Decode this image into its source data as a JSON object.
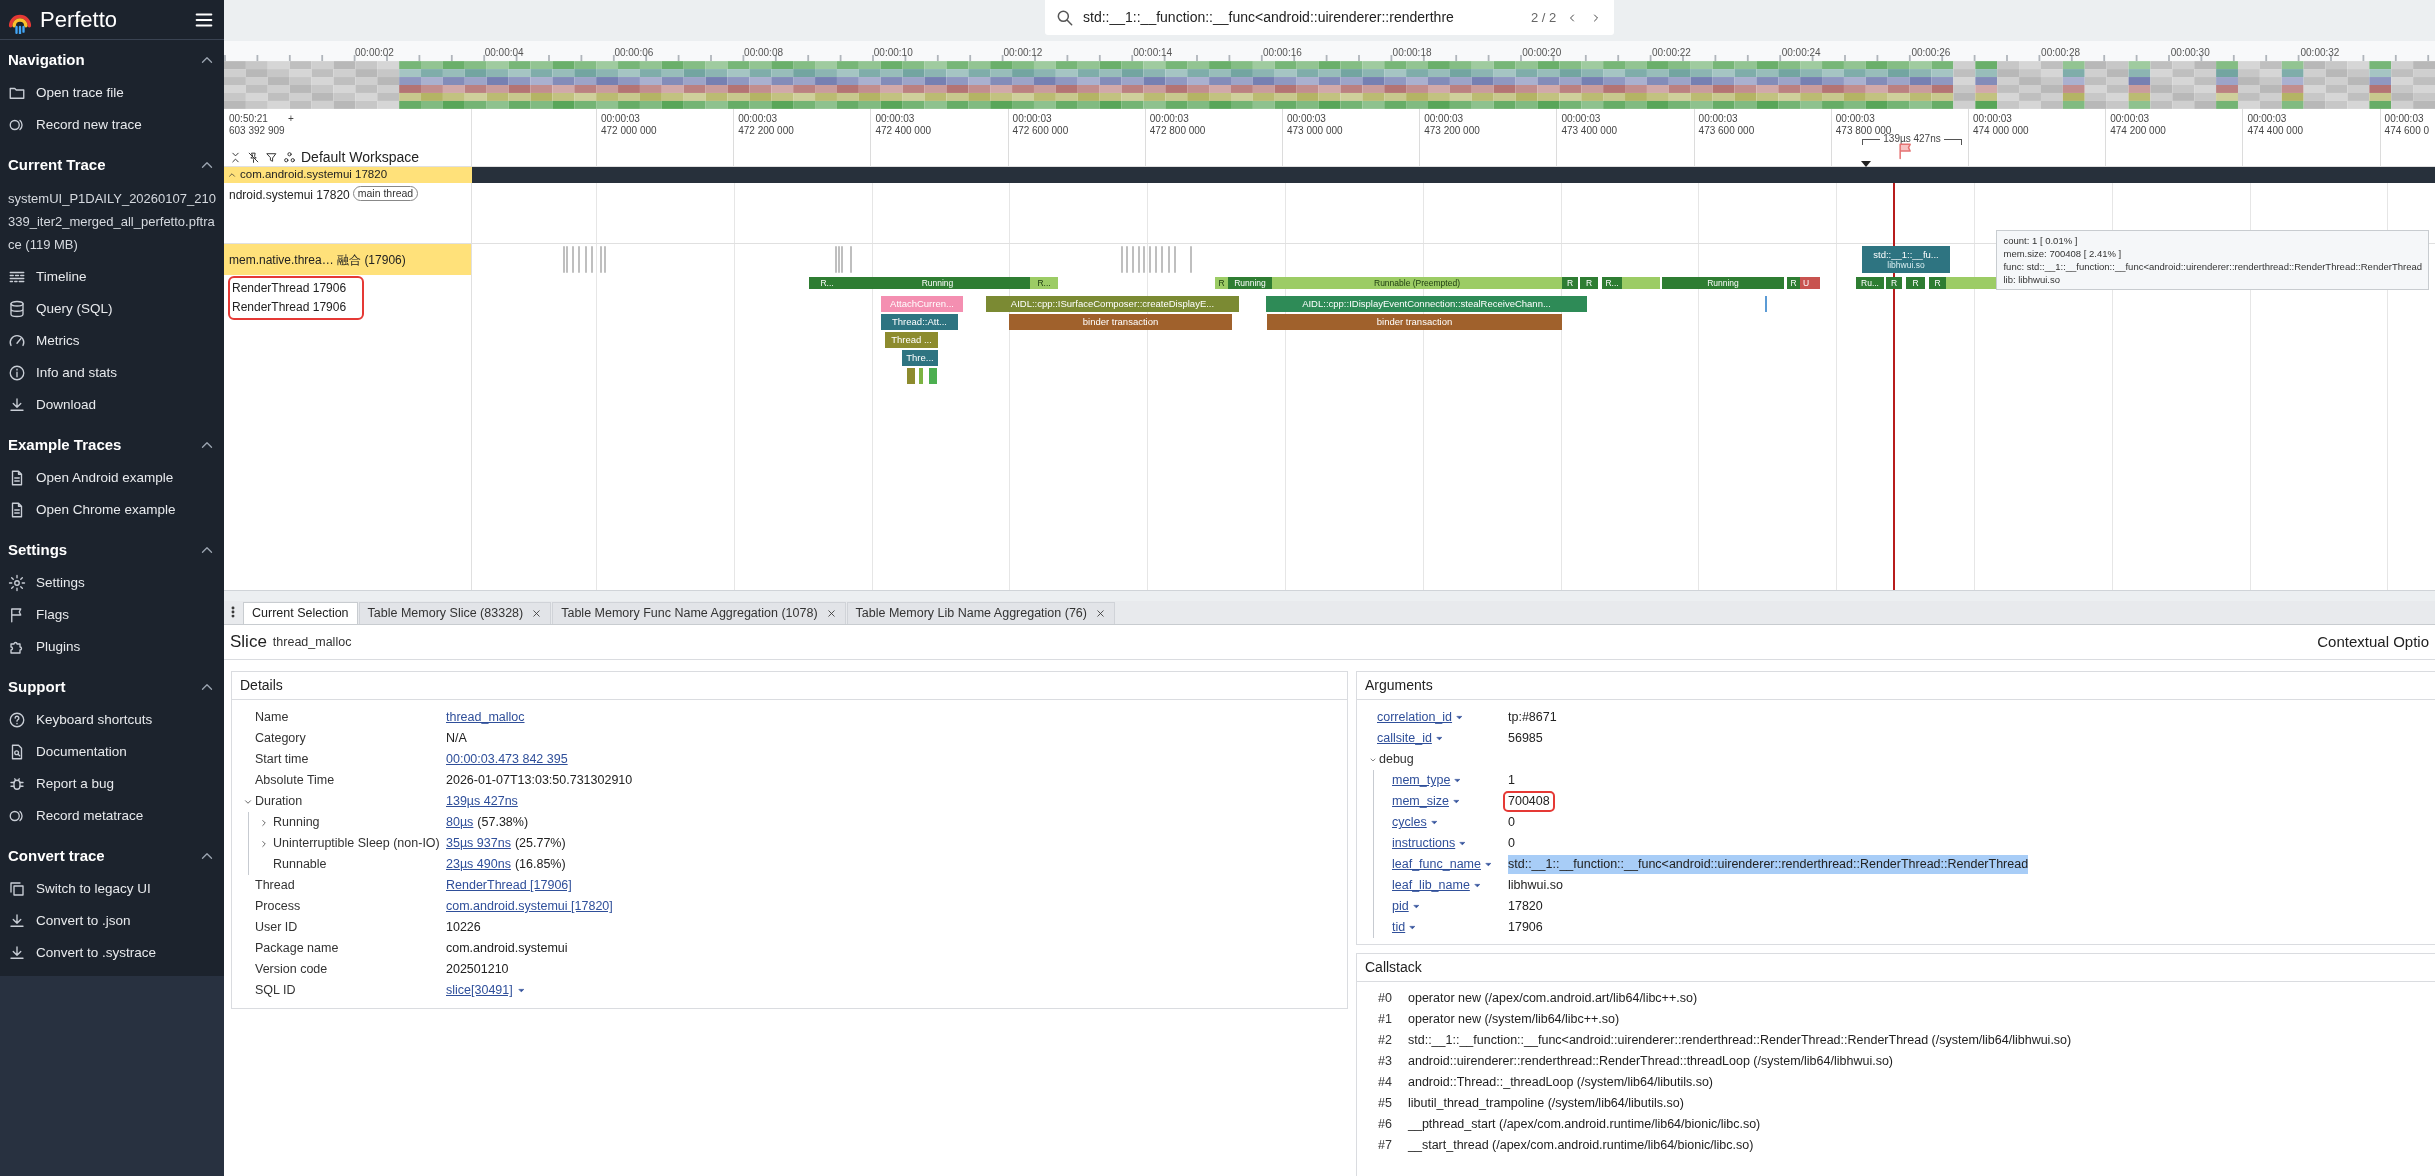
{
  "sidebar": {
    "title": "Perfetto",
    "sections": [
      {
        "title": "Navigation",
        "expanded": true,
        "items": [
          "Open trace file",
          "Record new trace"
        ]
      },
      {
        "title": "Current Trace",
        "expanded": true,
        "trace_file": "systemUI_P1DAILY_20260107_210339_iter2_merged_all_perfetto.pftrace (119 MB)",
        "items": [
          "Timeline",
          "Query (SQL)",
          "Metrics",
          "Info and stats",
          "Download"
        ]
      },
      {
        "title": "Example Traces",
        "expanded": true,
        "items": [
          "Open Android example",
          "Open Chrome example"
        ]
      },
      {
        "title": "Settings",
        "expanded": true,
        "items": [
          "Settings",
          "Flags",
          "Plugins"
        ]
      },
      {
        "title": "Support",
        "expanded": true,
        "items": [
          "Keyboard shortcuts",
          "Documentation",
          "Report a bug",
          "Record metatrace"
        ]
      },
      {
        "title": "Convert trace",
        "expanded": true,
        "items": [
          "Switch to legacy UI",
          "Convert to .json",
          "Convert to .systrace"
        ]
      }
    ]
  },
  "search": {
    "value": "std::__1::__function::__func<android::uirenderer::renderthre",
    "match_count": "2 / 2"
  },
  "overview": {
    "tick_labels": [
      "00:00:02",
      "00:00:04",
      "00:00:06",
      "00:00:08",
      "00:00:10",
      "00:00:12",
      "00:00:14",
      "00:00:16",
      "00:00:18",
      "00:00:20",
      "00:00:22",
      "00:00:24",
      "00:00:26",
      "00:00:28",
      "00:00:30",
      "00:00:32"
    ]
  },
  "timeline": {
    "origin_time": "00:50:21",
    "origin_plus": "+",
    "origin_ns": "603 392 909",
    "workspace": "Default Workspace",
    "measurement": "139µs 427ns",
    "ticks": [
      {
        "time": "00:00:03",
        "ns": "472 000 000"
      },
      {
        "time": "00:00:03",
        "ns": "472 200 000"
      },
      {
        "time": "00:00:03",
        "ns": "472 400 000"
      },
      {
        "time": "00:00:03",
        "ns": "472 600 000"
      },
      {
        "time": "00:00:03",
        "ns": "472 800 000"
      },
      {
        "time": "00:00:03",
        "ns": "473 000 000"
      },
      {
        "time": "00:00:03",
        "ns": "473 200 000"
      },
      {
        "time": "00:00:03",
        "ns": "473 400 000"
      },
      {
        "time": "00:00:03",
        "ns": "473 600 000"
      },
      {
        "time": "00:00:03",
        "ns": "473 800 000"
      },
      {
        "time": "00:00:03",
        "ns": "474 000 000"
      },
      {
        "time": "00:00:03",
        "ns": "474 200 000"
      },
      {
        "time": "00:00:03",
        "ns": "474 400 000"
      },
      {
        "time": "00:00:03",
        "ns": "474 600 0"
      }
    ]
  },
  "tracks": {
    "group": {
      "title": "com.android.systemui 17820",
      "expanded": true
    },
    "main_thread": {
      "label": "ndroid.systemui 17820",
      "chip": "main thread"
    },
    "mem_track": {
      "label": "mem.native.threa… 融合 (17906)",
      "slice": {
        "title": "std::__1::__fu...",
        "subtitle": "libhwui.so"
      }
    },
    "tooltip": [
      "count: 1 [ 0.01% ]",
      "mem.size: 700408 [ 2.41% ]",
      "func: std::__1::__function::__func<android::uirenderer::renderthread::RenderThread::RenderThread",
      "lib: libhwui.so"
    ],
    "render_threads": {
      "highlighted": true,
      "labels": [
        "RenderThread 17906",
        "RenderThread 17906"
      ]
    },
    "thread_states": [
      {
        "kind": "running",
        "label": "R..."
      },
      {
        "kind": "running",
        "label": "Running"
      },
      {
        "kind": "runnable",
        "label": "R..."
      },
      {
        "kind": "runnable",
        "label": "R"
      },
      {
        "kind": "running",
        "label": "Running"
      },
      {
        "kind": "runnable",
        "label": "Runnable (Preempted)"
      },
      {
        "kind": "running",
        "label": "R"
      },
      {
        "kind": "running",
        "label": "R"
      },
      {
        "kind": "running",
        "label": "R..."
      },
      {
        "kind": "runnable"
      },
      {
        "kind": "running",
        "label": "Running"
      },
      {
        "kind": "running",
        "label": "R"
      },
      {
        "kind": "uninterruptible",
        "label": "U"
      },
      {
        "kind": "uninterruptible"
      },
      {
        "kind": "running",
        "label": "Ru..."
      },
      {
        "kind": "running",
        "label": "R"
      },
      {
        "kind": "running",
        "label": "R"
      },
      {
        "kind": "running",
        "label": "R"
      },
      {
        "kind": "runnable"
      }
    ],
    "slices": [
      {
        "label": "AttachCurren...",
        "color": "#f48fb1"
      },
      {
        "label": "Thread::Att...",
        "color": "#2e7481"
      },
      {
        "label": "Thread ...",
        "color": "#8d8b2e"
      },
      {
        "label": "Thre...",
        "color": "#2e7481"
      },
      {
        "color": "#8d8b2e"
      },
      {
        "color": "#7cb342"
      },
      {
        "color": "#4caf50"
      },
      {
        "label": "AIDL::cpp::ISurfaceComposer::createDisplayE...",
        "color": "#7b8a33"
      },
      {
        "label": "binder transaction",
        "color": "#a0612c"
      },
      {
        "label": "AIDL::cpp::IDisplayEventConnection::stealReceiveChann...",
        "color": "#2e8b57"
      },
      {
        "label": "binder transaction",
        "color": "#a0612c"
      },
      {
        "color": "#5b9bd5"
      }
    ]
  },
  "tabs": [
    {
      "label": "Current Selection",
      "selected": true,
      "closable": false
    },
    {
      "label": "Table Memory Slice (83328)",
      "selected": false,
      "closable": true
    },
    {
      "label": "Table Memory Func Name Aggregation (1078)",
      "selected": false,
      "closable": true
    },
    {
      "label": "Table Memory Lib Name Aggregation (76)",
      "selected": false,
      "closable": true
    }
  ],
  "selection": {
    "kind_label": "Slice",
    "name": "thread_malloc",
    "contextual": "Contextual Optio"
  },
  "details": {
    "title": "Details",
    "rows": [
      {
        "label": "Name",
        "value": "thread_malloc",
        "link": true
      },
      {
        "label": "Category",
        "value": "N/A",
        "link": false
      },
      {
        "label": "Start time",
        "value": "00:00:03.473 842 395",
        "link": true
      },
      {
        "label": "Absolute Time",
        "value": "2026-01-07T13:03:50.731302910",
        "link": false
      },
      {
        "label": "Duration",
        "value": "139µs 427ns",
        "link": true,
        "expanded": true,
        "children": [
          {
            "label": "Running",
            "value": "80µs",
            "suffix": "(57.38%)",
            "link": true,
            "expanded": false
          },
          {
            "label": "Uninterruptible Sleep (non-IO)",
            "value": "35µs 937ns",
            "suffix": "(25.77%)",
            "link": true,
            "expanded": false
          },
          {
            "label": "Runnable",
            "value": "23µs 490ns",
            "suffix": "(16.85%)",
            "link": true
          }
        ]
      },
      {
        "label": "Thread",
        "value": "RenderThread [17906]",
        "link": true
      },
      {
        "label": "Process",
        "value": "com.android.systemui [17820]",
        "link": true
      },
      {
        "label": "User ID",
        "value": "10226",
        "link": false
      },
      {
        "label": "Package name",
        "value": "com.android.systemui",
        "link": false
      },
      {
        "label": "Version code",
        "value": "202501210",
        "link": false
      },
      {
        "label": "SQL ID",
        "value": "slice[30491]",
        "link": true,
        "menu": true
      }
    ]
  },
  "arguments": {
    "title": "Arguments",
    "rows": [
      {
        "key": "correlation_id",
        "value": "tp:#8671",
        "highlighted": false,
        "text_selected": false
      },
      {
        "key": "callsite_id",
        "value": "56985",
        "highlighted": false,
        "text_selected": false
      },
      {
        "key": "debug",
        "expanded": true,
        "children": [
          {
            "key": "mem_type",
            "value": "1",
            "highlighted": false,
            "text_selected": false
          },
          {
            "key": "mem_size",
            "value": "700408",
            "highlighted": true,
            "text_selected": false
          },
          {
            "key": "cycles",
            "value": "0",
            "highlighted": false,
            "text_selected": false
          },
          {
            "key": "instructions",
            "value": "0",
            "highlighted": false,
            "text_selected": false
          },
          {
            "key": "leaf_func_name",
            "value": "std::__1::__function::__func<android::uirenderer::renderthread::RenderThread::RenderThread",
            "highlighted": false,
            "text_selected": true
          },
          {
            "key": "leaf_lib_name",
            "value": "libhwui.so",
            "highlighted": false,
            "text_selected": false
          },
          {
            "key": "pid",
            "value": "17820",
            "highlighted": false,
            "text_selected": false
          },
          {
            "key": "tid",
            "value": "17906",
            "highlighted": false,
            "text_selected": false
          }
        ]
      }
    ]
  },
  "callstack": {
    "title": "Callstack",
    "frames": [
      {
        "index": "#0",
        "text": "operator new (/apex/com.android.art/lib64/libc++.so)"
      },
      {
        "index": "#1",
        "text": "operator new (/system/lib64/libc++.so)"
      },
      {
        "index": "#2",
        "text": "std::__1::__function::__func<android::uirenderer::renderthread::RenderThread::RenderThread (/system/lib64/libhwui.so)"
      },
      {
        "index": "#3",
        "text": "android::uirenderer::renderthread::RenderThread::threadLoop (/system/lib64/libhwui.so)"
      },
      {
        "index": "#4",
        "text": "android::Thread::_threadLoop (/system/lib64/libutils.so)"
      },
      {
        "index": "#5",
        "text": "libutil_thread_trampoline (/system/lib64/libutils.so)"
      },
      {
        "index": "#6",
        "text": "__pthread_start (/apex/com.android.runtime/lib64/bionic/libc.so)"
      },
      {
        "index": "#7",
        "text": "__start_thread (/apex/com.android.runtime/lib64/bionic/libc.so)"
      }
    ]
  }
}
